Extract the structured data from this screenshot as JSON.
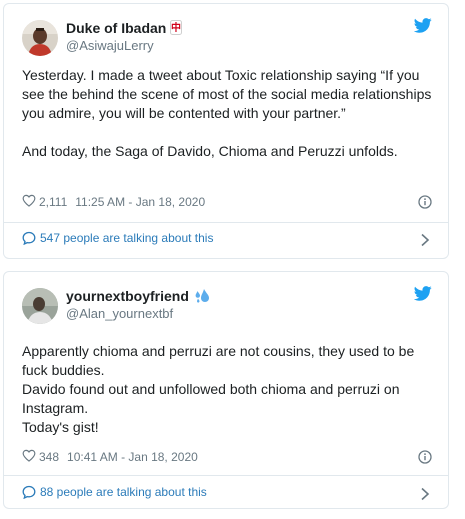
{
  "tweets": [
    {
      "name": "Duke of Ibadan",
      "handle": "@AsiwajuLerry",
      "name_emoji": "🀄",
      "paragraphs": [
        "Yesterday. I made a tweet about Toxic relationship saying “If you see the behind the scene of most of the social media relationships you admire, you will be contented with your partner.”",
        "And today, the Saga of Davido, Chioma and Peruzzi unfolds."
      ],
      "likes": "2,111",
      "timestamp": "11:25 AM - Jan 18, 2020",
      "talking": "547 people are talking about this"
    },
    {
      "name": "yournextboyfriend",
      "handle": "@Alan_yournextbf",
      "name_emoji": "💦",
      "paragraphs": [
        "Apparently chioma and perruzi are not cousins, they used to be fuck buddies.",
        "Davido found out and unfollowed both chioma and perruzi on Instagram.",
        "Today's gist!"
      ],
      "likes": "348",
      "timestamp": "10:41 AM - Jan 18, 2020",
      "talking": "88 people are talking about this"
    }
  ],
  "colors": {
    "accent": "#1da1f2",
    "link": "#2b7bb9",
    "muted": "#697882",
    "border": "#e1e8ed"
  }
}
